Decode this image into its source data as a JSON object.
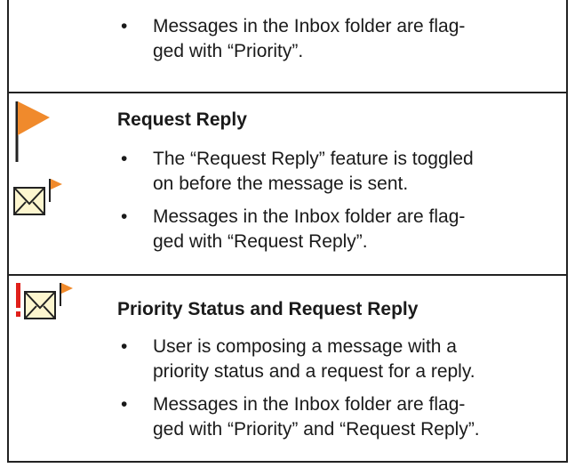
{
  "sections": [
    {
      "bullets": [
        {
          "line1": "Messages in the Inbox folder are flag-",
          "line2": "ged with “Priority”."
        }
      ]
    },
    {
      "heading": "Request Reply",
      "icons": [
        "orange-flag-icon",
        "envelope-flag-icon"
      ],
      "bullets": [
        {
          "line1": "The “Request Reply” feature is toggled",
          "line2": "on before the message is sent."
        },
        {
          "line1": "Messages in the Inbox folder are flag-",
          "line2": "ged with “Request Reply”."
        }
      ]
    },
    {
      "heading": "Priority Status and Request Reply",
      "icons": [
        "priority-envelope-flag-icon"
      ],
      "bullets": [
        {
          "line1": "User is composing a message with a",
          "line2": "priority status and a request for a reply."
        },
        {
          "line1": "Messages in the Inbox folder are flag-",
          "line2": "ged with “Priority” and “Request Reply”."
        }
      ]
    }
  ],
  "bullet_glyph": "•",
  "colors": {
    "flag": "#f08a2c",
    "priority": "#e0201b",
    "envelope_fill": "#fdf6cf",
    "border": "#222222"
  }
}
